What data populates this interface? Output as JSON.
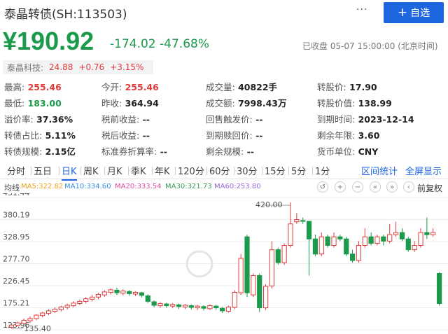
{
  "header": {
    "title": "泰晶转债(SH:113503)",
    "more_label": "···",
    "fav_plus": "+",
    "fav_label": "自选"
  },
  "quote": {
    "price": "¥190.92",
    "change": "-174.02 -47.68%",
    "status": "已收盘 05-07 15:00:00 (北京时间)"
  },
  "underlying": {
    "name": "泰晶科技:",
    "price": "24.88",
    "change": "+0.76",
    "pct": "+3.15%"
  },
  "stats": [
    [
      {
        "k": "最高:",
        "v": "255.46",
        "c": "red"
      },
      {
        "k": "今开:",
        "v": "255.46",
        "c": "red"
      },
      {
        "k": "成交量:",
        "v": "40822手",
        "c": ""
      },
      {
        "k": "转股价:",
        "v": "17.90",
        "c": ""
      }
    ],
    [
      {
        "k": "最低:",
        "v": "183.00",
        "c": "green"
      },
      {
        "k": "昨收:",
        "v": "364.94",
        "c": ""
      },
      {
        "k": "成交额:",
        "v": "7998.43万",
        "c": ""
      },
      {
        "k": "转股价值:",
        "v": "138.99",
        "c": ""
      }
    ],
    [
      {
        "k": "溢价率:",
        "v": "37.36%",
        "c": ""
      },
      {
        "k": "税前收益:",
        "v": "--",
        "c": ""
      },
      {
        "k": "回售触发价:",
        "v": "--",
        "c": ""
      },
      {
        "k": "到期时间:",
        "v": "2023-12-14",
        "c": ""
      }
    ],
    [
      {
        "k": "转债占比:",
        "v": "5.11%",
        "c": ""
      },
      {
        "k": "税后收益:",
        "v": "--",
        "c": ""
      },
      {
        "k": "到期赎回价:",
        "v": "--",
        "c": ""
      },
      {
        "k": "剩余年限:",
        "v": "3.60",
        "c": ""
      }
    ],
    [
      {
        "k": "转债规模:",
        "v": "2.15亿",
        "c": ""
      },
      {
        "k": "标准券折算率:",
        "v": "--",
        "c": ""
      },
      {
        "k": "剩余规模:",
        "v": "--",
        "c": ""
      },
      {
        "k": "货币单位:",
        "v": "CNY",
        "c": ""
      }
    ]
  ],
  "tabs": [
    "分时",
    "五日",
    "日K",
    "周K",
    "月K",
    "季K",
    "年K",
    "120分",
    "60分",
    "30分",
    "15分",
    "5分",
    "1分"
  ],
  "active_tab": "日K",
  "right_tabs": [
    "区间统计",
    "全屏显示"
  ],
  "tools": {
    "label": "均线",
    "ma": [
      {
        "text": "MA5:322.82",
        "color": "#f0a020"
      },
      {
        "text": "MA10:334.60",
        "color": "#3a8ee6"
      },
      {
        "text": "MA20:333.54",
        "color": "#e04ea0"
      },
      {
        "text": "MA30:321.73",
        "color": "#3a9a5a"
      },
      {
        "text": "MA60:253.80",
        "color": "#9a6ad8"
      }
    ],
    "buttons": [
      "↺",
      "+",
      "−",
      "«",
      "»",
      "‹",
      "›"
    ],
    "adjust": "前复权"
  },
  "chart_data": {
    "type": "candlestick",
    "y_ticks": [
      "431.44",
      "380.19",
      "328.95",
      "277.70",
      "226.45",
      "175.21",
      "123.96"
    ],
    "ylim": [
      123.96,
      431.44
    ],
    "max_label": "420.00",
    "min_label": "135.40",
    "candles": [
      [
        130,
        135,
        127,
        137
      ],
      [
        134,
        140,
        132,
        143
      ],
      [
        139,
        146,
        137,
        150
      ],
      [
        145,
        150,
        140,
        155
      ],
      [
        150,
        158,
        146,
        160
      ],
      [
        157,
        163,
        153,
        166
      ],
      [
        162,
        168,
        158,
        172
      ],
      [
        167,
        172,
        163,
        176
      ],
      [
        171,
        177,
        167,
        180
      ],
      [
        176,
        181,
        171,
        185
      ],
      [
        180,
        186,
        176,
        190
      ],
      [
        185,
        190,
        181,
        194
      ],
      [
        190,
        196,
        185,
        200
      ],
      [
        195,
        200,
        190,
        205
      ],
      [
        200,
        206,
        195,
        210
      ],
      [
        205,
        212,
        200,
        216
      ],
      [
        211,
        217,
        206,
        220
      ],
      [
        216,
        210,
        205,
        222
      ],
      [
        209,
        214,
        204,
        218
      ],
      [
        213,
        208,
        203,
        216
      ],
      [
        207,
        211,
        202,
        214
      ],
      [
        210,
        204,
        199,
        212
      ],
      [
        203,
        190,
        186,
        206
      ],
      [
        189,
        181,
        176,
        192
      ],
      [
        180,
        185,
        175,
        188
      ],
      [
        184,
        180,
        175,
        187
      ],
      [
        179,
        183,
        174,
        186
      ],
      [
        182,
        178,
        172,
        185
      ],
      [
        177,
        181,
        172,
        184
      ],
      [
        180,
        176,
        171,
        183
      ],
      [
        175,
        179,
        170,
        182
      ],
      [
        178,
        174,
        169,
        181
      ],
      [
        173,
        180,
        170,
        183
      ],
      [
        179,
        175,
        170,
        182
      ],
      [
        174,
        168,
        163,
        177
      ],
      [
        167,
        177,
        164,
        180
      ],
      [
        176,
        211,
        172,
        216
      ],
      [
        210,
        290,
        205,
        300
      ],
      [
        340,
        210,
        200,
        345
      ],
      [
        205,
        250,
        200,
        255
      ],
      [
        250,
        175,
        165,
        255
      ],
      [
        175,
        225,
        170,
        230
      ],
      [
        226,
        310,
        220,
        330
      ],
      [
        310,
        280,
        275,
        315
      ],
      [
        280,
        320,
        275,
        325
      ],
      [
        320,
        370,
        315,
        420
      ],
      [
        375,
        380,
        370,
        395
      ],
      [
        378,
        376,
        370,
        385
      ],
      [
        376,
        335,
        250,
        340
      ],
      [
        335,
        300,
        295,
        345
      ],
      [
        300,
        340,
        295,
        350
      ],
      [
        340,
        320,
        315,
        345
      ],
      [
        320,
        340,
        315,
        350
      ],
      [
        340,
        335,
        330,
        345
      ],
      [
        335,
        300,
        295,
        340
      ],
      [
        300,
        285,
        280,
        310
      ],
      [
        285,
        320,
        280,
        330
      ],
      [
        320,
        340,
        315,
        360
      ],
      [
        340,
        325,
        320,
        350
      ],
      [
        325,
        340,
        320,
        345
      ],
      [
        340,
        330,
        320,
        345
      ],
      [
        330,
        345,
        325,
        370
      ],
      [
        345,
        350,
        340,
        375
      ],
      [
        350,
        335,
        330,
        360
      ],
      [
        335,
        310,
        305,
        340
      ],
      [
        310,
        320,
        305,
        330
      ],
      [
        320,
        350,
        315,
        360
      ],
      [
        350,
        345,
        335,
        385
      ],
      [
        345,
        350,
        340,
        360
      ],
      [
        255,
        185,
        180,
        258
      ]
    ]
  }
}
